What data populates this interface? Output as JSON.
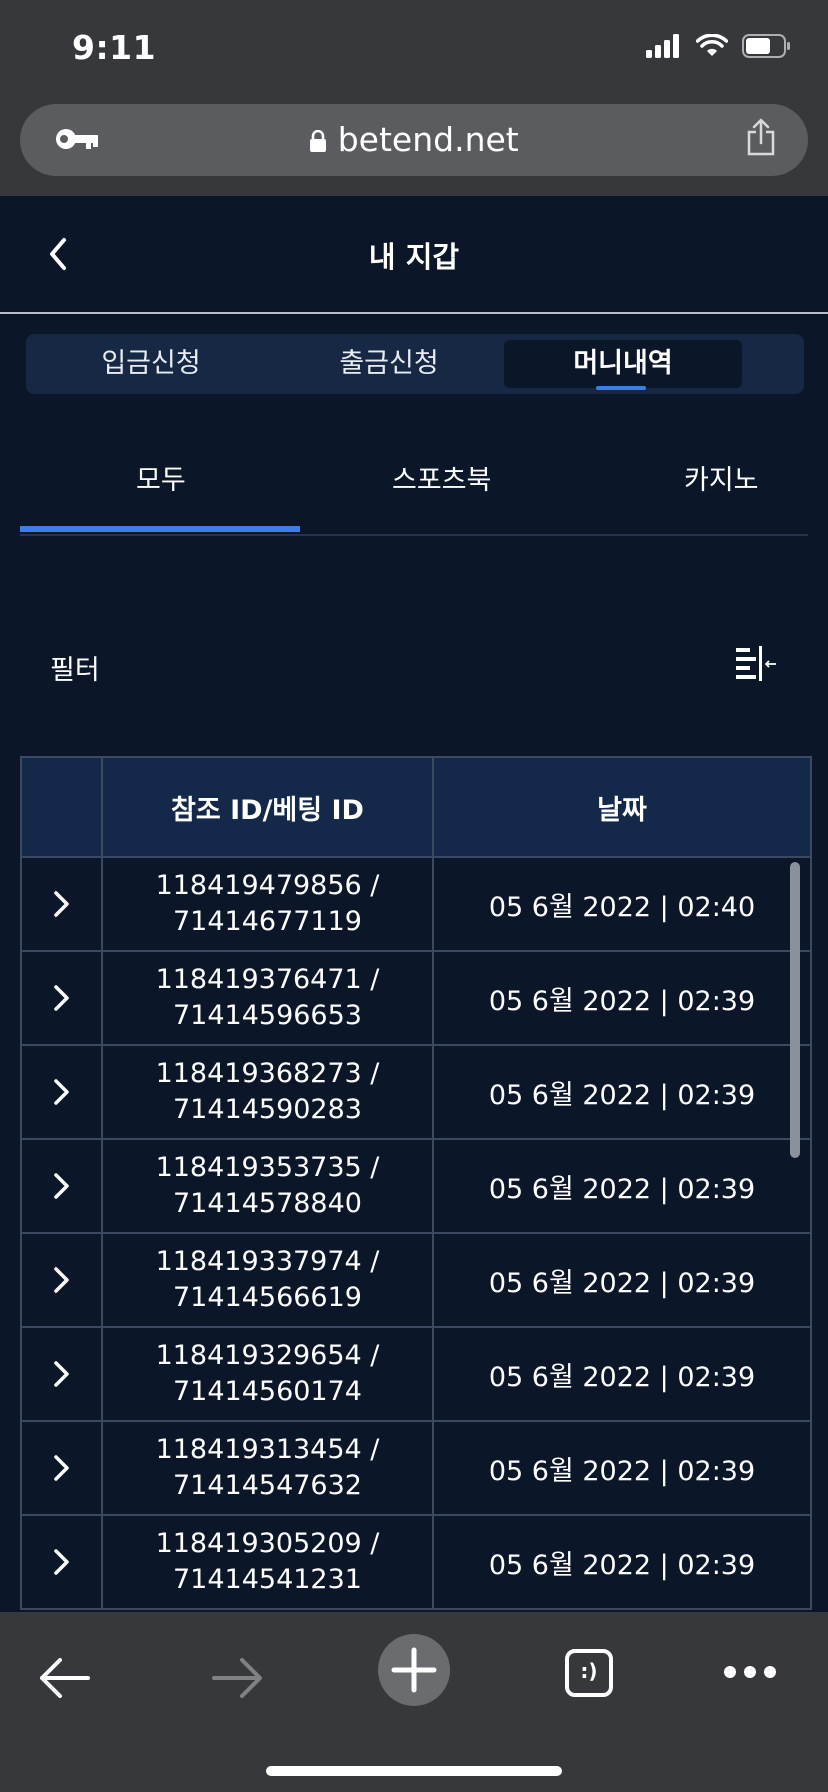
{
  "status_bar": {
    "time": "9:11"
  },
  "browser": {
    "url": "betend.net"
  },
  "header": {
    "title": "내 지갑"
  },
  "seg_tabs": [
    {
      "label": "입금신청",
      "active": false
    },
    {
      "label": "출금신청",
      "active": false
    },
    {
      "label": "머니내역",
      "active": true
    }
  ],
  "category_tabs": [
    {
      "label": "모두",
      "active": true
    },
    {
      "label": "스포츠북",
      "active": false
    },
    {
      "label": "카지노",
      "active": false
    }
  ],
  "filter": {
    "label": "필터"
  },
  "table": {
    "headers": [
      "",
      "참조 ID/베팅 ID",
      "날짜"
    ],
    "rows": [
      {
        "ref": "118419479856 /",
        "bet": "71414677119",
        "date": "05 6월 2022 | 02:40"
      },
      {
        "ref": "118419376471 /",
        "bet": "71414596653",
        "date": "05 6월 2022 | 02:39"
      },
      {
        "ref": "118419368273 /",
        "bet": "71414590283",
        "date": "05 6월 2022 | 02:39"
      },
      {
        "ref": "118419353735 /",
        "bet": "71414578840",
        "date": "05 6월 2022 | 02:39"
      },
      {
        "ref": "118419337974 /",
        "bet": "71414566619",
        "date": "05 6월 2022 | 02:39"
      },
      {
        "ref": "118419329654 /",
        "bet": "71414560174",
        "date": "05 6월 2022 | 02:39"
      },
      {
        "ref": "118419313454 /",
        "bet": "71414547632",
        "date": "05 6월 2022 | 02:39"
      },
      {
        "ref": "118419305209 /",
        "bet": "71414541231",
        "date": "05 6월 2022 | 02:39"
      }
    ]
  },
  "toolbar": {
    "tabs_icon_label": ":)"
  },
  "colors": {
    "background": "#0b1628",
    "accent": "#3c7ee8",
    "browser_chrome": "#37383b"
  }
}
